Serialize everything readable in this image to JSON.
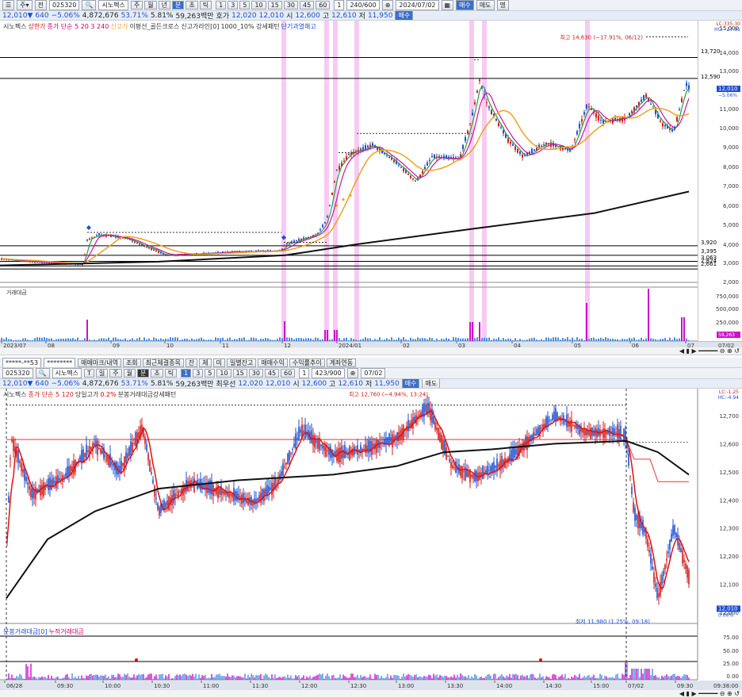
{
  "top": {
    "toolbar1": {
      "code": "025320",
      "btn_jeon": "전",
      "name": "시노펙스",
      "periods": [
        "주",
        "월",
        "년",
        "분",
        "초",
        "틱"
      ],
      "minutes": [
        "1",
        "3",
        "5",
        "10",
        "15",
        "30",
        "45",
        "60"
      ],
      "one": "1",
      "count": "240/600",
      "date": "2024/07/02",
      "buy": "매수",
      "sell": "매도",
      "extra": "명"
    },
    "quote": {
      "price": "12,010▼",
      "change": "640",
      "pct": "−5.06%",
      "volume": "4,872,676",
      "ratio": "53.71%",
      "turnover": "5.81%",
      "amount": "59,263백만",
      "bid_label": "호가",
      "bid": "12,020",
      "bid2": "12,010",
      "open_label": "시",
      "open": "12,600",
      "high_label": "고",
      "high": "12,610",
      "low_label": "저",
      "low": "11,950",
      "mode": "매수"
    },
    "legend": [
      "시노펙스",
      "상한가",
      "종가 단순 5 20 3 240",
      "신고가",
      "이평선_골든크로스",
      "신고가라인[0]",
      "1000_10% 강세패턴",
      "단기과열해고"
    ],
    "price_scale": [
      "15,000",
      "14,000",
      "13,000",
      "12,000",
      "11,000",
      "10,000",
      "9,000",
      "8,000",
      "7,000",
      "6,000",
      "5,000",
      "4,000",
      "3,000",
      "2,000"
    ],
    "levels": [
      {
        "label": "13,720",
        "value": 13720
      },
      {
        "label": "12,590",
        "value": 12590
      },
      {
        "label": "3,920",
        "value": 3920
      },
      {
        "label": "3,395",
        "value": 3395
      },
      {
        "label": "3,063",
        "value": 3063
      },
      {
        "label": "2,824",
        "value": 2824
      },
      {
        "label": "2,661",
        "value": 2661
      }
    ],
    "current_price": "12,010",
    "current_pct": "−5.06%",
    "lc_hc": "LC:335.30\nHC:−17.91",
    "high_annotation": "최고 14,630 (−17.91%, 06/12)",
    "volume_label": "거래대금",
    "volume_scale": [
      "750,000",
      "500,000",
      "250,000"
    ],
    "volume_now": "59,263",
    "dates": [
      "2023/07",
      "08",
      "09",
      "10",
      "11",
      "12",
      "2024/01",
      "02",
      "03",
      "04",
      "05",
      "06",
      "07"
    ],
    "date_right": "07/02"
  },
  "bottom": {
    "toolbar1": {
      "account": "*****-**53",
      "password": "********",
      "buttons": [
        "매매마크/내역",
        "조회",
        "최근체결종목",
        "잔",
        "체",
        "미",
        "일별잔고",
        "매매수익",
        "수익률추이",
        "계좌연동"
      ]
    },
    "toolbar2": {
      "code": "025320",
      "name": "시노펙스",
      "periods": [
        "T",
        "일",
        "주",
        "월",
        "분",
        "초",
        "틱"
      ],
      "minutes": [
        "1",
        "3",
        "5",
        "10",
        "15",
        "30",
        "45",
        "60"
      ],
      "one": "1",
      "count": "423/900",
      "date": "07/02"
    },
    "quote": {
      "price": "12,010▼",
      "change": "640",
      "pct": "−5.06%",
      "volume": "4,872,676",
      "ratio": "53.71%",
      "turnover": "5.81%",
      "amount": "59,263백만",
      "close_label": "최우선",
      "bid": "12,020",
      "bid2": "12,010",
      "open_label": "시",
      "open": "12,600",
      "high_label": "고",
      "high": "12,610",
      "low_label": "저",
      "low": "11,950",
      "buy": "매수",
      "sell": "매도"
    },
    "legend": [
      "시노펙스",
      "종가 단순 5 120",
      "당일고가",
      "0.2%",
      "분봉거래대금강세패턴"
    ],
    "price_scale": [
      "12,700",
      "12,600",
      "12,500",
      "12,400",
      "12,300",
      "12,200",
      "12,100",
      "12,000"
    ],
    "current_price": "12,010",
    "current_pct": "0.00%",
    "lc_hc": "LC:-1.25\nHC:-4.94",
    "high_annotation": "최고 12,760 (−4.94%, 13:24)",
    "low_annotation": "최저 11,980 (1.25%, 09:18)",
    "volume_legend": [
      "분봉거래대금[0]",
      "누적거래대금"
    ],
    "volume_scale": [
      "75.00",
      "50.00",
      "25.00",
      "0.00"
    ],
    "times": [
      "06/28",
      "09:30",
      "10:00",
      "10:30",
      "11:00",
      "11:30",
      "12:00",
      "12:30",
      "13:00",
      "13:30",
      "14:00",
      "14:30",
      "15:00",
      "07/02",
      "09:30"
    ],
    "time_right": "09:38:00"
  },
  "colors": {
    "up": "#d11c1c",
    "down": "#1c4fd1",
    "ma5": "#2b9a3a",
    "ma20": "#cc11aa",
    "ma60": "#f0a020",
    "ma240": "#111111",
    "highlight": "#f4b8f0"
  }
}
